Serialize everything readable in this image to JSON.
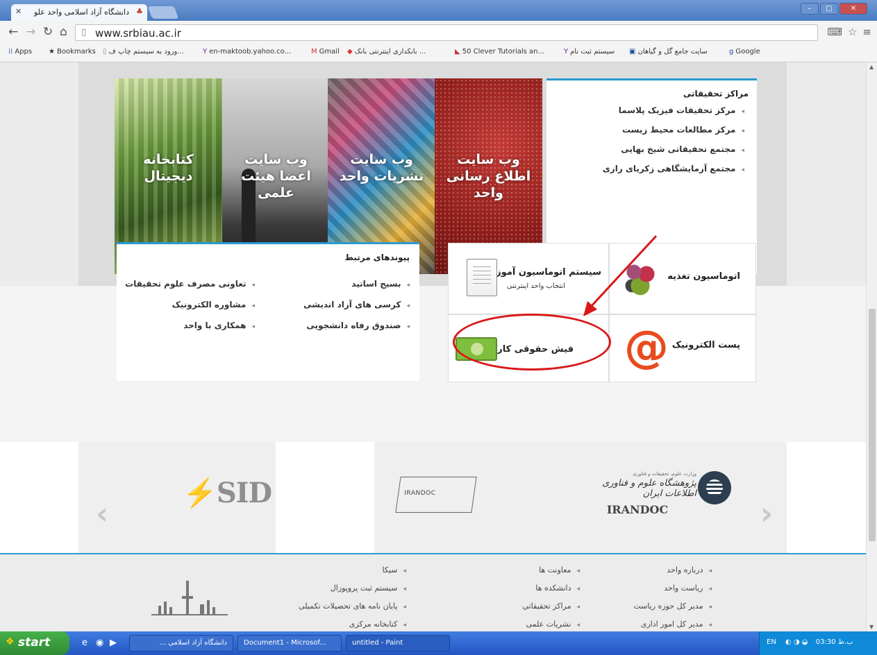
{
  "browser": {
    "tab_title": "دانشگاه آزاد اسلامی واحد علو",
    "tab_close": "✕",
    "url": "www.srbiau.ac.ir",
    "window_buttons": [
      "–",
      "▢",
      "✕"
    ]
  },
  "bookmarks": [
    {
      "icon": "apps-icon",
      "label": "Apps"
    },
    {
      "icon": "star-icon",
      "label": "Bookmarks"
    },
    {
      "icon": "page-icon",
      "label": "ورود به سیستم چاپ ف..."
    },
    {
      "icon": "yahoo-icon",
      "label": "en-maktoob.yahoo.co..."
    },
    {
      "icon": "gmail-icon",
      "label": "Gmail"
    },
    {
      "icon": "bank-icon",
      "label": "بانکداری اینترنتی بانک ..."
    },
    {
      "icon": "tutorial-icon",
      "label": "50 Clever Tutorials an..."
    },
    {
      "icon": "yahoo-icon",
      "label": "سیستم ثبت نام"
    },
    {
      "icon": "flower-icon",
      "label": "سایت جامع گل و گیاهان"
    },
    {
      "icon": "google-icon",
      "label": "Google"
    }
  ],
  "banners": [
    {
      "text": "کتابخانه\nدیجیتال"
    },
    {
      "text": "وب سایت\nاعضا هیئت علمی"
    },
    {
      "text": "وب سایت\nنشریات واحد"
    },
    {
      "text": "وب سایت\nاطلاع رسانی\nواحد"
    }
  ],
  "research_centers": {
    "title": "مراکز تحقیقاتی",
    "items": [
      "مرکز تحقیقات فیزیک پلاسما",
      "مرکز مطالعات محیط زیست",
      "مجتمع تحقیقاتی شیخ بهایی",
      "مجتمع آزمایشگاهی زکریای رازی"
    ]
  },
  "related_links": {
    "title": "پیوندهای مرتبط",
    "col1": [
      "بسیج اساتید",
      "کرسی های آزاد اندیشی",
      "صندوق رفاه دانشجویی"
    ],
    "col2": [
      "تعاونی مصرف علوم تحقیقات",
      "مشاوره الکترونیک",
      "همکاری با واحد"
    ]
  },
  "tiles": {
    "nutrition": "اتوماسیون تغذیه",
    "education_title": "سیستم اتوماسیون آموزش",
    "education_sub": "انتخاب واحد اینترنتی",
    "email": "پست الکترونیک",
    "payslip": "فیش حقوقی کارکنان"
  },
  "partners": {
    "sid": "SID",
    "irandoc_box": "IRANDOC",
    "irandoc_small": "وزارت علوم، تحقیقات و فناوری",
    "irandoc_fa": "پژوهشگاه علوم و فناوری اطلاعات ایران",
    "irandoc_en": "IRANDOC"
  },
  "footer": {
    "col1": [
      "درباره واحد",
      "ریاست واحد",
      "مدیر کل حوزه ریاست",
      "مدیر کل امور اداری"
    ],
    "col2": [
      "معاونت ها",
      "دانشکده ها",
      "مراکز تحقیقاتی",
      "نشریات علمی"
    ],
    "col3": [
      "سیکا",
      "سیستم ثبت پروپوزال",
      "پایان نامه های تحصیلات تکمیلی",
      "کتابخانه مرکزی"
    ]
  },
  "taskbar": {
    "start": "start",
    "tasks": [
      "دانشگاه آزاد اسلامی ...",
      "Document1 - Microsof...",
      "untitled - Paint"
    ],
    "lang": "EN",
    "clock": "03:30 ب.ظ"
  },
  "colors": {
    "accent": "#2a9ad0",
    "annotation": "#d81818",
    "taskbar": "#2456c4"
  }
}
